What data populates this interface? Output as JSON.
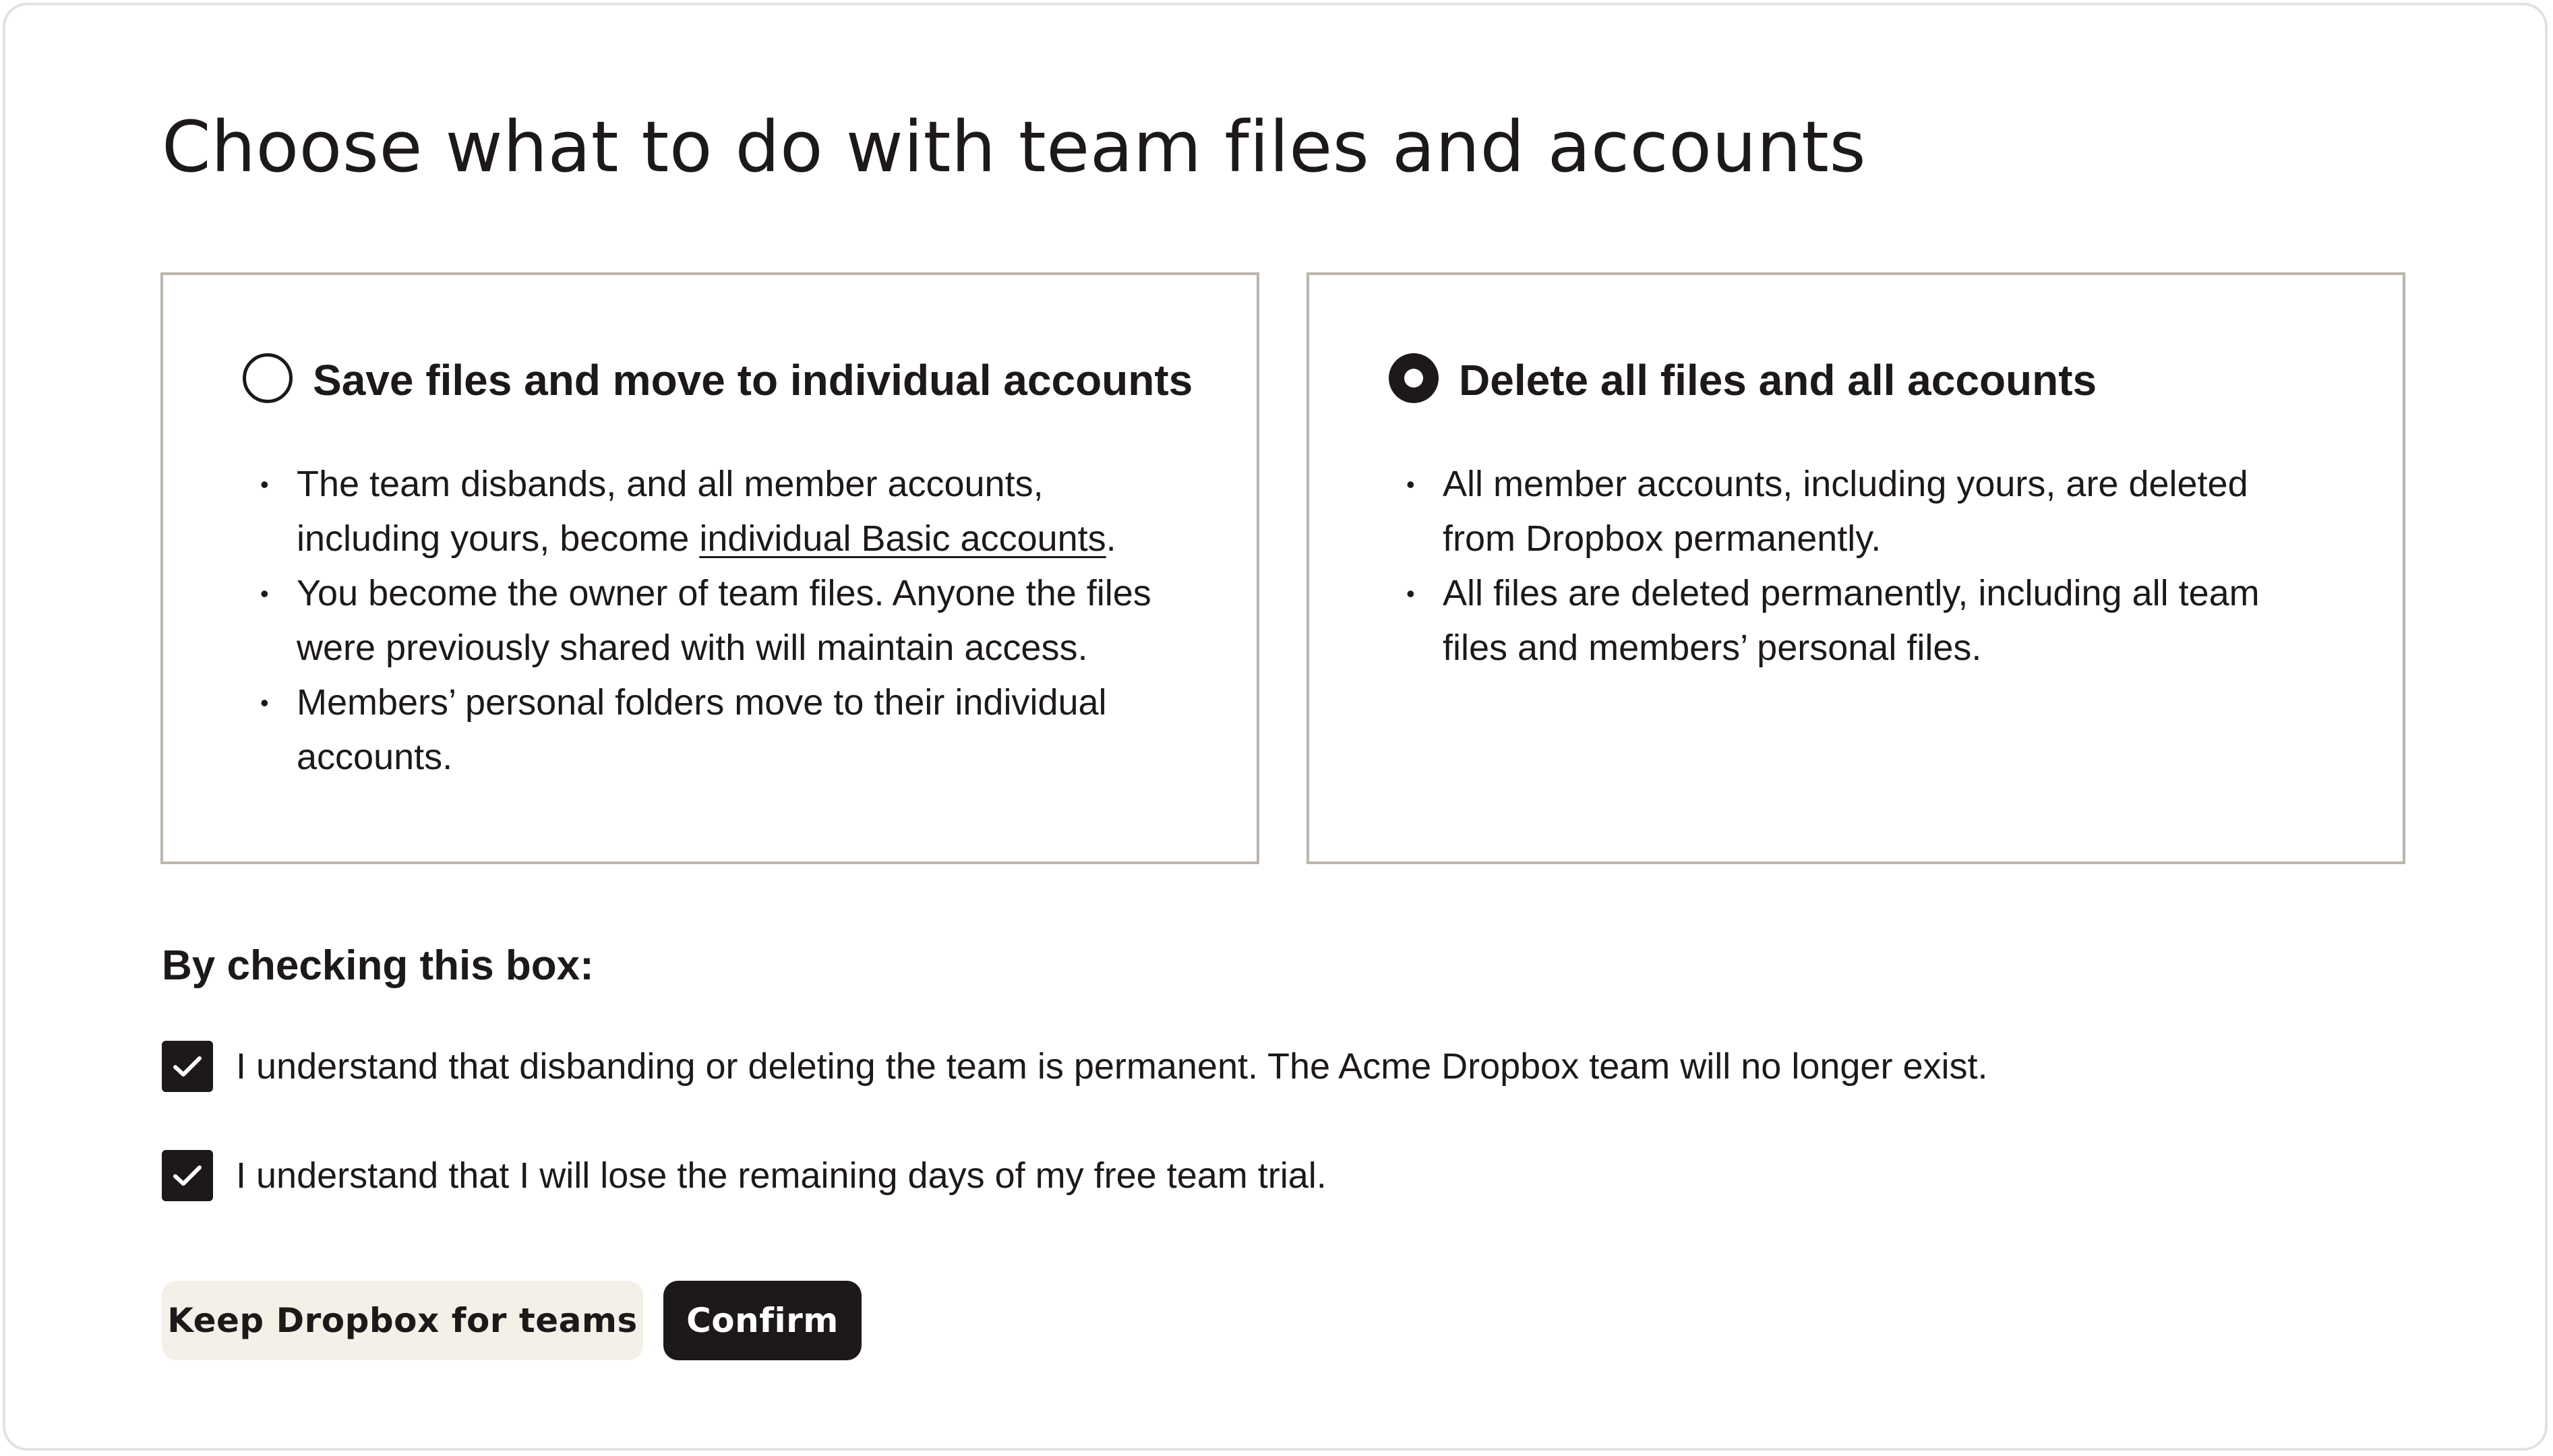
{
  "page": {
    "title": "Choose what to do with team files and accounts"
  },
  "options": {
    "save": {
      "title": "Save files and move to individual accounts",
      "selected": false,
      "bullet1_line1": "The team disbands, and all member accounts,",
      "bullet1_line2_prefix": "including yours, become ",
      "bullet1_link": "individual Basic accounts",
      "bullet1_line2_suffix": ".",
      "bullet2_line1": "You become the owner of team files. Anyone the files",
      "bullet2_line2": "were previously shared with will maintain access.",
      "bullet3_line1": "Members’ personal folders move to their individual",
      "bullet3_line2": "accounts."
    },
    "delete": {
      "title": "Delete all files and all accounts",
      "selected": true,
      "bullet1_line1": "All member accounts, including yours, are deleted",
      "bullet1_line2": "from Dropbox permanently.",
      "bullet2_line1": "All files are deleted permanently, including all team",
      "bullet2_line2": "files and members’ personal files."
    }
  },
  "agreement": {
    "heading": "By checking this box:",
    "checks": [
      {
        "label": "I understand that disbanding or deleting the team is permanent. The Acme Dropbox team will no longer exist.",
        "checked": true
      },
      {
        "label": "I understand that I will lose the remaining days of my free team trial.",
        "checked": true
      }
    ]
  },
  "actions": {
    "secondary_label": "Keep Dropbox for teams",
    "primary_label": "Confirm"
  },
  "colors": {
    "text": "#1e1919",
    "card_border": "#bbb5ae",
    "secondary_button_bg": "#f4f0e8",
    "primary_button_bg": "#1e1919"
  },
  "icons": {
    "checkbox": "check-icon",
    "radio_selected": "radio-selected-icon",
    "radio_unselected": "radio-unselected-icon"
  }
}
